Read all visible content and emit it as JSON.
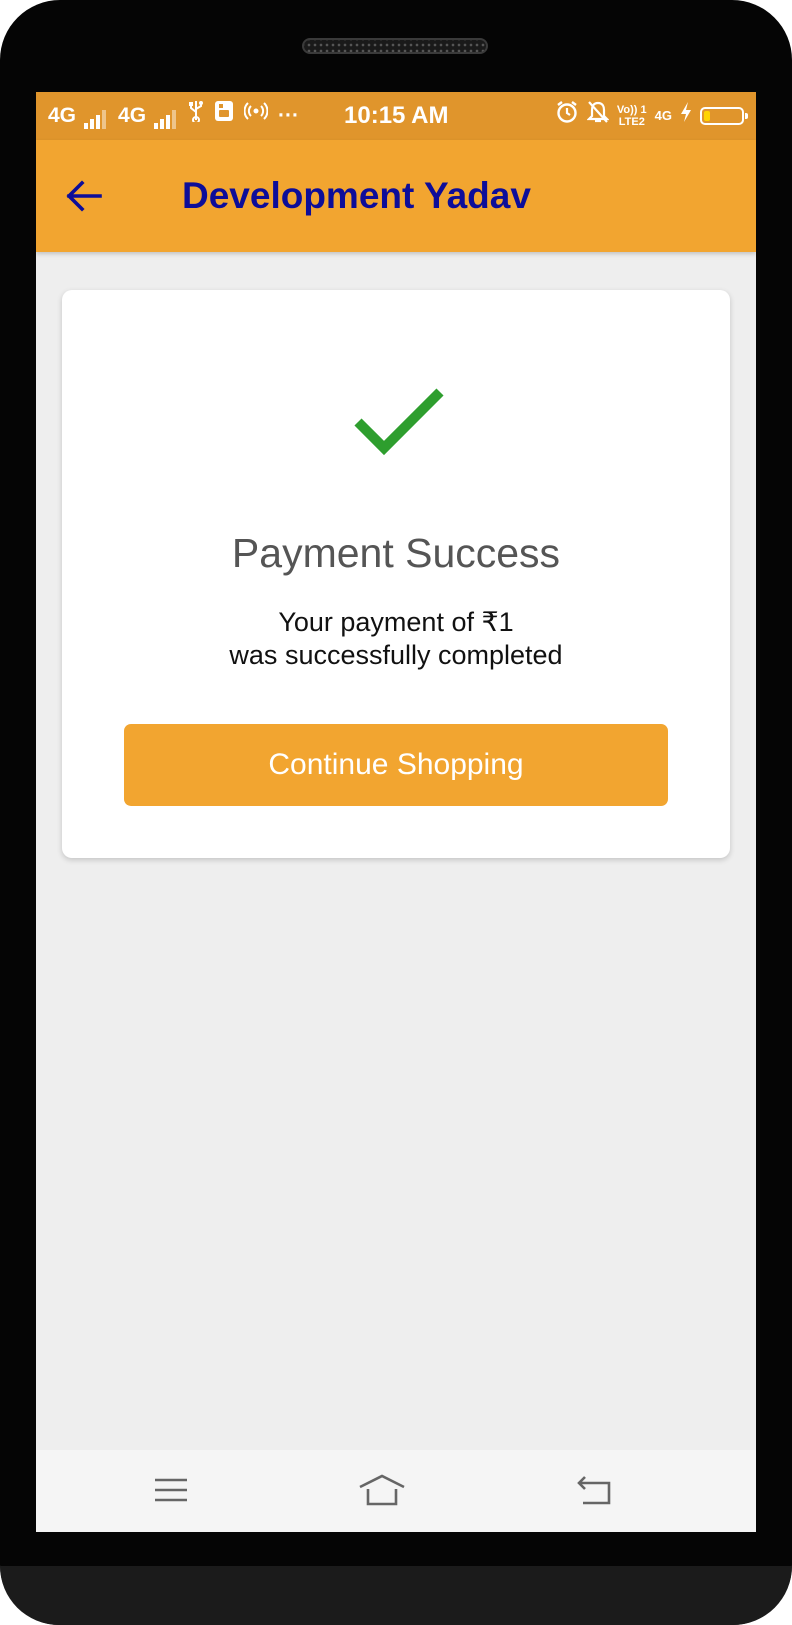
{
  "status_bar": {
    "sim1_network": "4G",
    "sim2_network": "4G",
    "time": "10:15 AM",
    "overflow_indicator": "···",
    "volte_top": "Vo)) 1",
    "volte_bottom": "LTE2",
    "data_network": "4G",
    "battery_level": 0.18,
    "icons": [
      "usb-icon",
      "sim-toolkit-icon",
      "hotspot-icon",
      "alarm-icon",
      "notifications-off-icon",
      "charging-icon"
    ]
  },
  "app_bar": {
    "title": "Development Yadav",
    "back_icon": "arrow-left-icon",
    "title_color": "#0d0d99",
    "background": "#f2a530"
  },
  "card": {
    "status_icon": "checkmark-icon",
    "status_color": "#2e9e2e",
    "title": "Payment Success",
    "message_line1": "Your payment of ₹1",
    "message_line2": "was successfully completed",
    "button_label": "Continue Shopping",
    "button_color": "#f2a530"
  },
  "nav_bar": {
    "icons": [
      "menu-icon",
      "home-icon",
      "back-icon"
    ]
  }
}
